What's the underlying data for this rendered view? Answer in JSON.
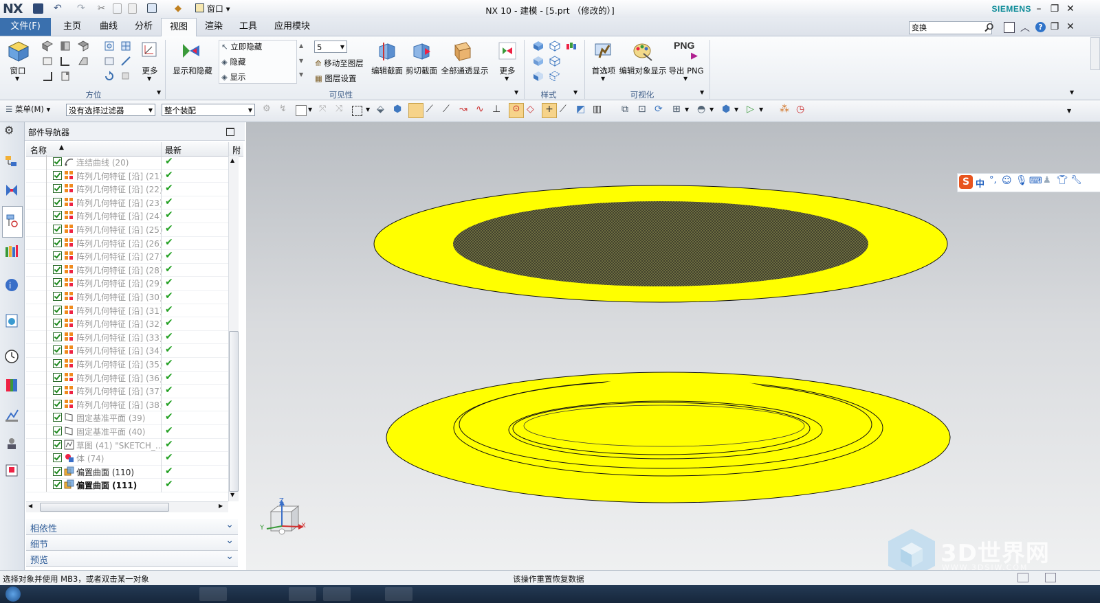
{
  "app": {
    "logo": "NX",
    "window_title": "NX 10 - 建模 - [5.prt （修改的）]",
    "brand": "SIEMENS",
    "quick_access_window": "窗口"
  },
  "ribbon_tabs": [
    "文件(F)",
    "主页",
    "曲线",
    "分析",
    "视图",
    "渲染",
    "工具",
    "应用模块"
  ],
  "active_tab": "视图",
  "command_search": {
    "value": "变换"
  },
  "ribbon": {
    "window_label": "窗口",
    "orient_more": "更多",
    "orient_group": "方位",
    "show_hide": "显示和隐藏",
    "immediate_hide": "立即隐藏",
    "hide": "隐藏",
    "show": "显示",
    "layer_value": "5",
    "move_to_layer": "移动至图层",
    "layer_settings": "图层设置",
    "edit_section": "编辑截面",
    "clip_section": "剪切截面",
    "all_through": "全部通透显示",
    "visibility_more": "更多",
    "visibility_group": "可见性",
    "style_group": "样式",
    "preferences": "首选项",
    "edit_object_display": "编辑对象显示",
    "export_png_icon": "PNG",
    "export_png": "导出 PNG",
    "visualization_group": "可视化"
  },
  "toolbar2": {
    "menu": "菜单(M)",
    "filter": "没有选择过滤器",
    "assembly_scope": "整个装配"
  },
  "navigator": {
    "title": "部件导航器",
    "col_name": "名称",
    "col_latest": "最新",
    "col_extra": "附",
    "rows": [
      {
        "label": "连结曲线 (20)",
        "style": "gray",
        "icon": "curve"
      },
      {
        "label": "阵列几何特征 [沿] (21)",
        "style": "gray",
        "icon": "pattern"
      },
      {
        "label": "阵列几何特征 [沿] (22)",
        "style": "gray",
        "icon": "pattern"
      },
      {
        "label": "阵列几何特征 [沿] (23)",
        "style": "gray",
        "icon": "pattern"
      },
      {
        "label": "阵列几何特征 [沿] (24)",
        "style": "gray",
        "icon": "pattern"
      },
      {
        "label": "阵列几何特征 [沿] (25)",
        "style": "gray",
        "icon": "pattern"
      },
      {
        "label": "阵列几何特征 [沿] (26)",
        "style": "gray",
        "icon": "pattern"
      },
      {
        "label": "阵列几何特征 [沿] (27)",
        "style": "gray",
        "icon": "pattern"
      },
      {
        "label": "阵列几何特征 [沿] (28)",
        "style": "gray",
        "icon": "pattern"
      },
      {
        "label": "阵列几何特征 [沿] (29)",
        "style": "gray",
        "icon": "pattern"
      },
      {
        "label": "阵列几何特征 [沿] (30)",
        "style": "gray",
        "icon": "pattern"
      },
      {
        "label": "阵列几何特征 [沿] (31)",
        "style": "gray",
        "icon": "pattern"
      },
      {
        "label": "阵列几何特征 [沿] (32)",
        "style": "gray",
        "icon": "pattern"
      },
      {
        "label": "阵列几何特征 [沿] (33)",
        "style": "gray",
        "icon": "pattern"
      },
      {
        "label": "阵列几何特征 [沿] (34)",
        "style": "gray",
        "icon": "pattern"
      },
      {
        "label": "阵列几何特征 [沿] (35)",
        "style": "gray",
        "icon": "pattern"
      },
      {
        "label": "阵列几何特征 [沿] (36)",
        "style": "gray",
        "icon": "pattern"
      },
      {
        "label": "阵列几何特征 [沿] (37)",
        "style": "gray",
        "icon": "pattern"
      },
      {
        "label": "阵列几何特征 [沿] (38)",
        "style": "gray",
        "icon": "pattern"
      },
      {
        "label": "固定基准平面 (39)",
        "style": "gray",
        "icon": "plane"
      },
      {
        "label": "固定基准平面 (40)",
        "style": "gray",
        "icon": "plane"
      },
      {
        "label": "草图 (41) \"SKETCH_...",
        "style": "gray",
        "icon": "sketch"
      },
      {
        "label": "体 (74)",
        "style": "gray",
        "icon": "body"
      },
      {
        "label": "偏置曲面 (110)",
        "style": "normal",
        "icon": "offset"
      },
      {
        "label": "偏置曲面 (111)",
        "style": "bold",
        "icon": "offset"
      }
    ],
    "panels": [
      "相依性",
      "细节",
      "预览"
    ]
  },
  "viewport": {
    "triad_x": "X",
    "triad_y": "Y",
    "triad_z": "Z",
    "part_color": "#ffff00",
    "mesh_color": "#3b3b2c",
    "watermark": "3D世界网",
    "watermark_sub": "WWW.3DSJW.COM"
  },
  "ime": {
    "lang": "中"
  },
  "status": {
    "left": "选择对象并使用 MB3，或者双击某一对象",
    "center": "该操作重置恢复数据"
  }
}
